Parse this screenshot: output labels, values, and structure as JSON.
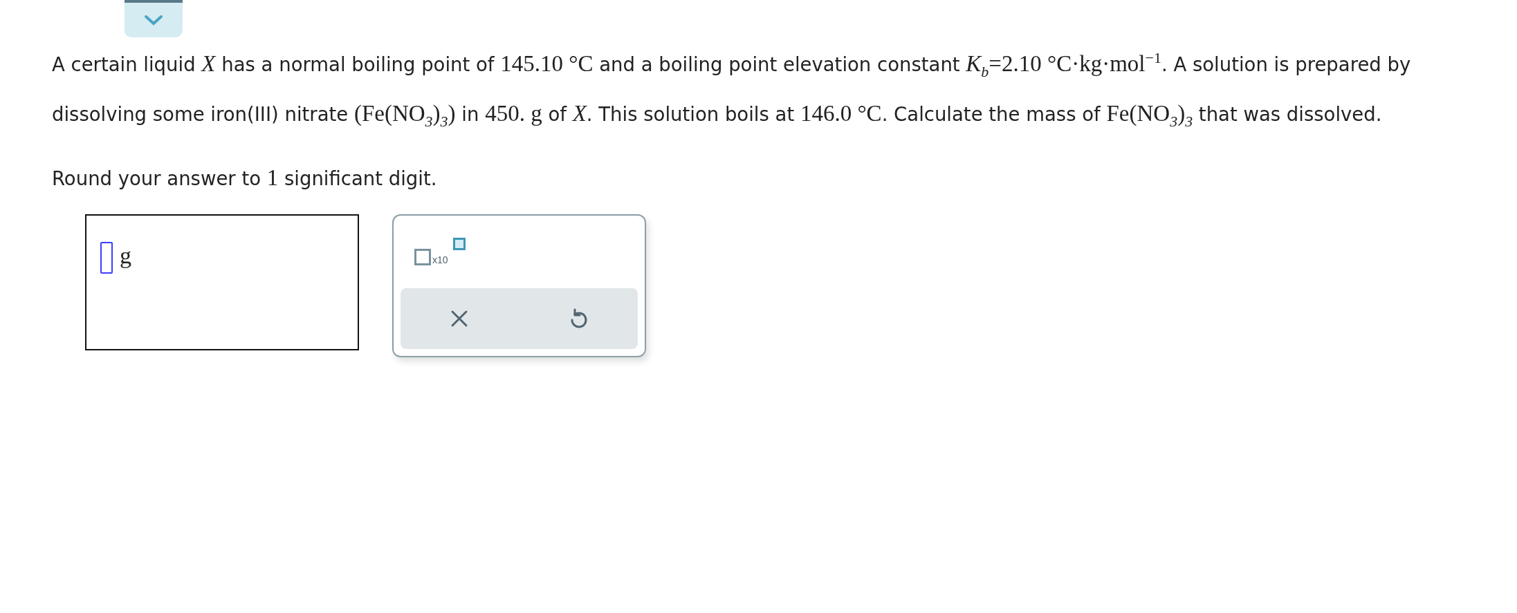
{
  "paragraphs": [
    [
      {
        "kind": "text",
        "text": "A certain liquid "
      },
      {
        "kind": "math",
        "text": "*X*"
      },
      {
        "kind": "text",
        "text": " has a normal boiling point of "
      },
      {
        "kind": "math",
        "text": "145.10 °C"
      },
      {
        "kind": "text",
        "text": " and a boiling point elevation constant "
      },
      {
        "kind": "math",
        "text": "*K*$_{b}$=2.10 °C·kg·mol$^{−1}$"
      },
      {
        "kind": "text",
        "text": ". A solution is prepared by dissolving some iron(III) nitrate "
      },
      {
        "kind": "math",
        "text": "(Fe(NO$_{3}$)$_{3}$)"
      },
      {
        "kind": "text",
        "text": " in "
      },
      {
        "kind": "math",
        "text": "450. g"
      },
      {
        "kind": "text",
        "text": " of "
      },
      {
        "kind": "math",
        "text": "*X*"
      },
      {
        "kind": "text",
        "text": ". This solution boils at "
      },
      {
        "kind": "math",
        "text": "146.0 °C"
      },
      {
        "kind": "text",
        "text": ". Calculate the mass of "
      },
      {
        "kind": "math",
        "text": "Fe(NO$_{3}$)$_{3}$"
      },
      {
        "kind": "text",
        "text": " that was dissolved."
      }
    ],
    [
      {
        "kind": "text",
        "text": "Round your answer to "
      },
      {
        "kind": "math",
        "text": "1"
      },
      {
        "kind": "text",
        "text": " significant digit."
      }
    ]
  ],
  "answer": {
    "unit": "g"
  },
  "tools": {
    "exponent_label": "x10"
  }
}
